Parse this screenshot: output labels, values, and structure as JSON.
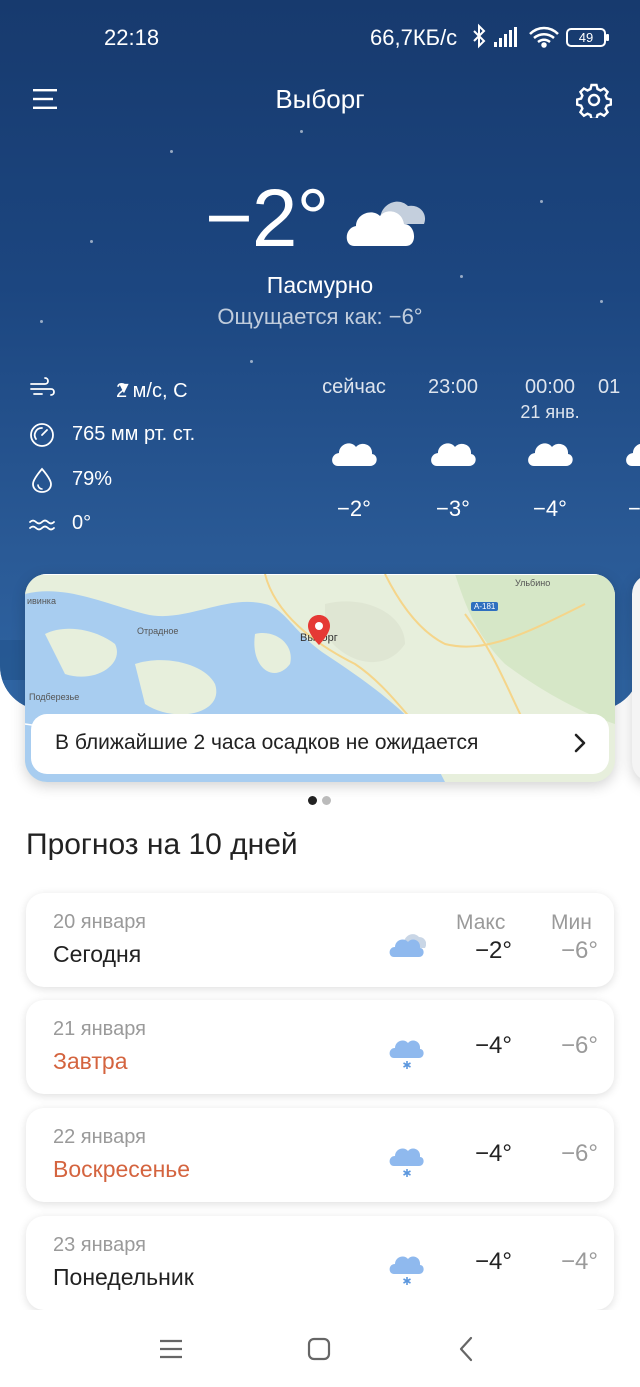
{
  "status_bar": {
    "time": "22:18",
    "speed": "66,7КБ/с",
    "battery": "49"
  },
  "header": {
    "city": "Выборг"
  },
  "current": {
    "temperature": "−2°",
    "condition": "Пасмурно",
    "feels_like": "Ощущается как: −6°",
    "icon": "overcast-cloud-icon"
  },
  "metrics": {
    "wind": "2 м/с, С",
    "pressure": "765 мм рт. ст.",
    "humidity": "79%",
    "water_temp": "0°"
  },
  "hourly": [
    {
      "label": "сейчас",
      "date": "",
      "temp": "−2°",
      "icon": "cloud-icon"
    },
    {
      "label": "23:00",
      "date": "",
      "temp": "−3°",
      "icon": "cloud-icon"
    },
    {
      "label": "00:00",
      "date": "21 янв.",
      "temp": "−4°",
      "icon": "cloud-icon"
    },
    {
      "label": "01",
      "date": "",
      "temp": "−",
      "icon": "cloud-icon"
    }
  ],
  "map": {
    "city_label": "Выборг",
    "places": [
      "Ульбино",
      "Отрадное",
      "Подберезье",
      "ивинка",
      "А-181"
    ],
    "precipitation": "В ближайшие 2 часа осадков не ожидается",
    "pin_color": "#e53935"
  },
  "forecast": {
    "title": "Прогноз на 10 дней",
    "max_header": "Макс",
    "min_header": "Мин",
    "days": [
      {
        "date": "20 января",
        "name": "Сегодня",
        "max": "−2°",
        "min": "−6°",
        "icon": "cloud-icon",
        "weekend": false
      },
      {
        "date": "21 января",
        "name": "Завтра",
        "max": "−4°",
        "min": "−6°",
        "icon": "snow-cloud-icon",
        "weekend": true
      },
      {
        "date": "22 января",
        "name": "Воскресенье",
        "max": "−4°",
        "min": "−6°",
        "icon": "snow-cloud-icon",
        "weekend": true
      },
      {
        "date": "23 января",
        "name": "Понедельник",
        "max": "−4°",
        "min": "−4°",
        "icon": "snow-cloud-icon",
        "weekend": false
      }
    ]
  },
  "colors": {
    "sky_top": "#173a6e",
    "weekend_red": "#d4643f",
    "icon_blue": "#8fb9ee"
  }
}
